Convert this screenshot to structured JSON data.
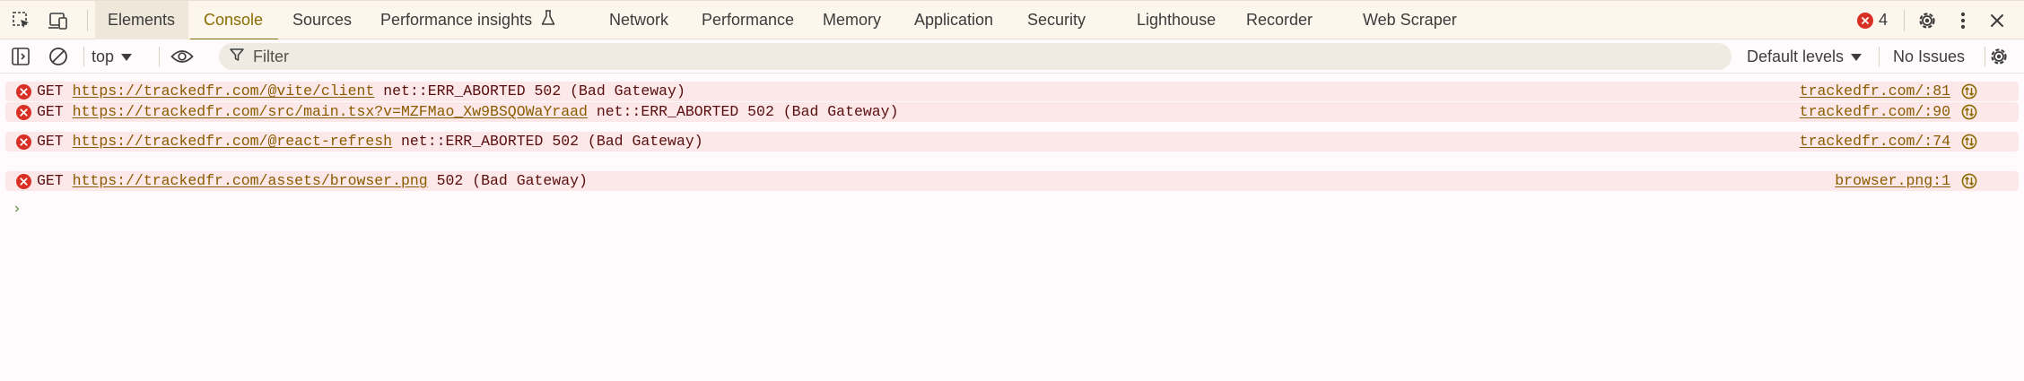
{
  "tabs": [
    {
      "label": "Elements",
      "active": true
    },
    {
      "label": "Console",
      "selected": true
    },
    {
      "label": "Sources"
    },
    {
      "label": "Performance insights"
    },
    {
      "label": "Network"
    },
    {
      "label": "Performance"
    },
    {
      "label": "Memory"
    },
    {
      "label": "Application"
    },
    {
      "label": "Security"
    },
    {
      "label": "Lighthouse"
    },
    {
      "label": "Recorder"
    },
    {
      "label": "Web Scraper"
    }
  ],
  "error_count": "4",
  "toolbar": {
    "context": "top",
    "filter_placeholder": "Filter",
    "levels": "Default levels",
    "issues": "No Issues"
  },
  "messages": [
    {
      "method": "GET",
      "url": "https://trackedfr.com/@vite/client",
      "error": "net::ERR_ABORTED 502 (Bad Gateway)",
      "source": "trackedfr.com/:81"
    },
    {
      "method": "GET",
      "url": "https://trackedfr.com/src/main.tsx?v=MZFMao_Xw9BSQOWaYraad",
      "error": "net::ERR_ABORTED 502 (Bad Gateway)",
      "source": "trackedfr.com/:90"
    },
    {
      "method": "GET",
      "url": "https://trackedfr.com/@react-refresh",
      "error": "net::ERR_ABORTED 502 (Bad Gateway)",
      "source": "trackedfr.com/:74"
    },
    {
      "method": "GET",
      "url": "https://trackedfr.com/assets/browser.png",
      "error": "502 (Bad Gateway)",
      "source": "browser.png:1"
    }
  ],
  "prompt_symbol": "›",
  "icons": {
    "inspect": "inspect-element-icon",
    "device": "device-toolbar-icon",
    "flask": "experiment-flask-icon",
    "settings": "gear-icon",
    "more": "kebab-menu-icon",
    "close": "close-icon",
    "sidebar": "sidebar-toggle-icon",
    "clear": "clear-console-icon",
    "eye": "live-expression-eye-icon",
    "filter": "filter-funnel-icon",
    "error": "error-circle-icon",
    "network": "network-request-icon"
  },
  "colors": {
    "accent": "#8a6c00",
    "error_bg": "#fce8e8",
    "error_icon": "#d93025",
    "tabbar_bg": "#fcf6ec"
  }
}
